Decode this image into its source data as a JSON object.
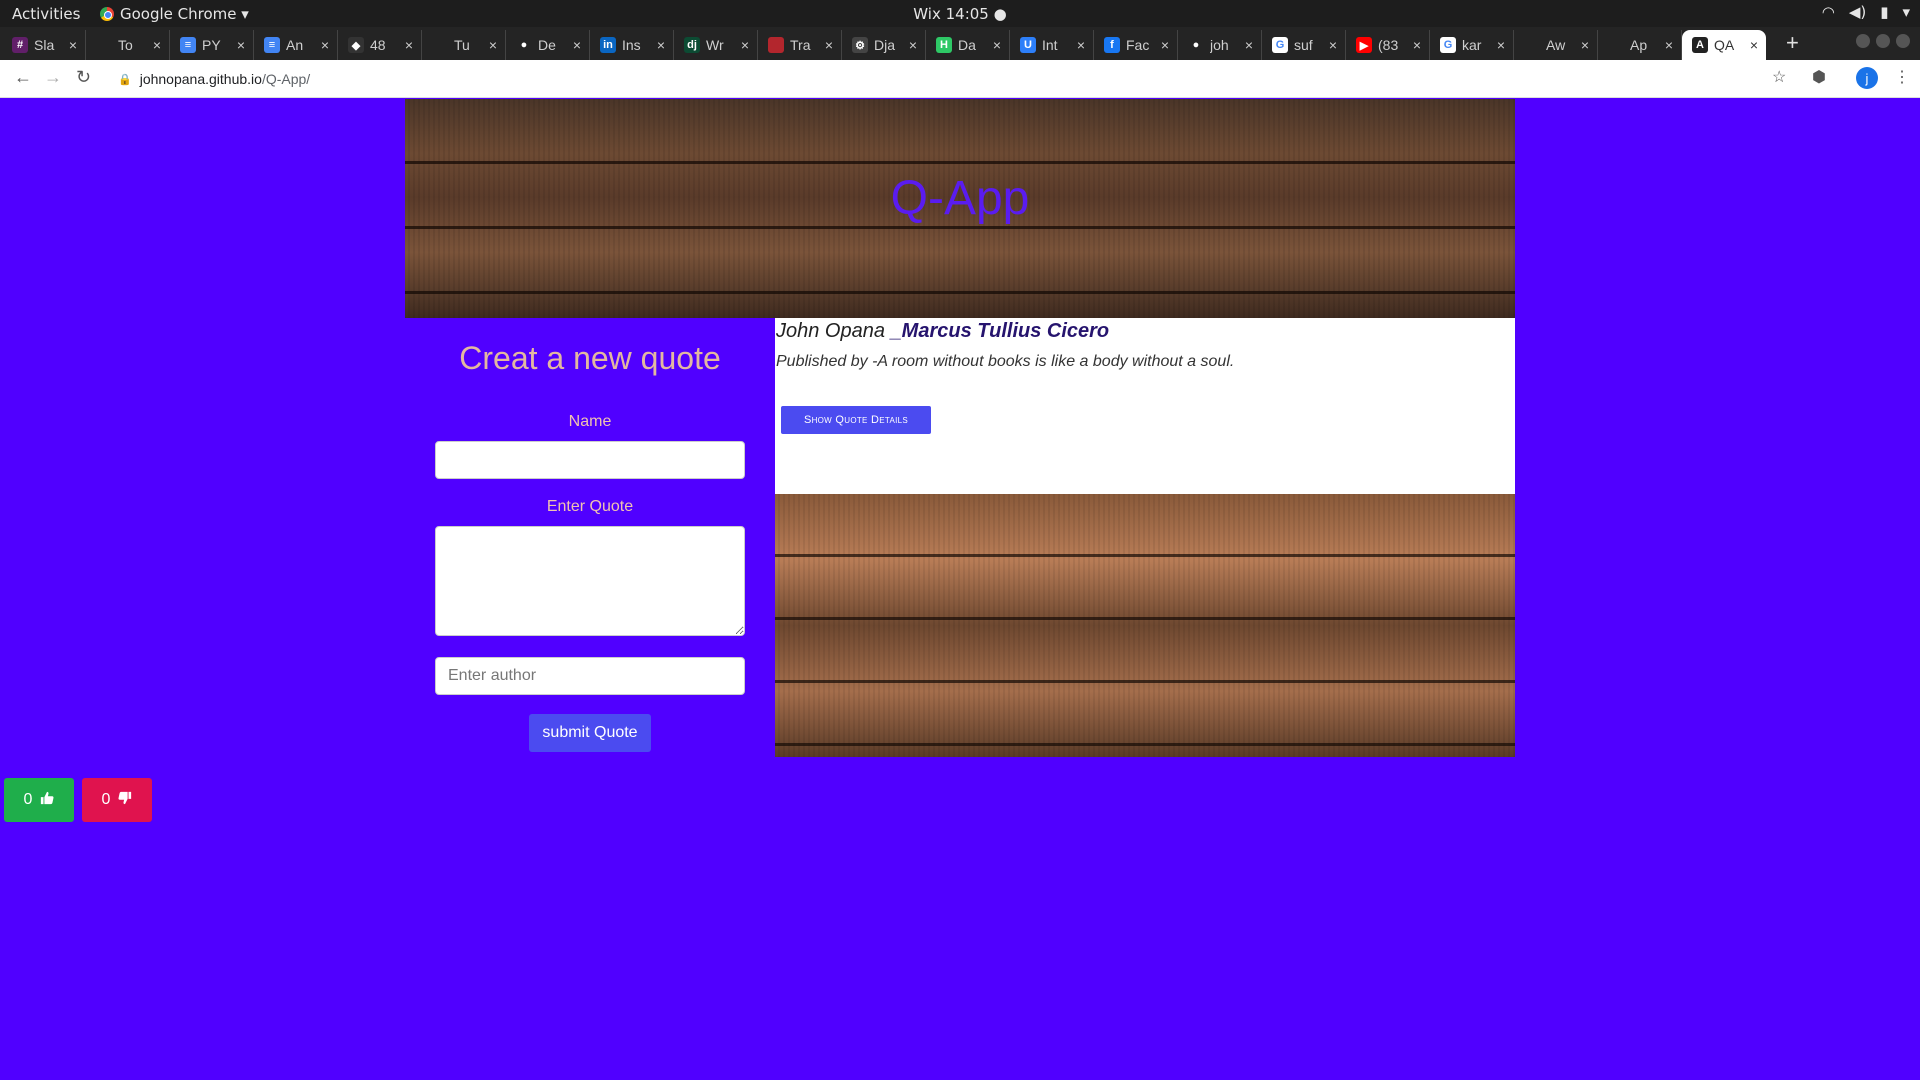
{
  "system": {
    "activities": "Activities",
    "app_name": "Google Chrome ▾",
    "clock": "Wix 14:05 ●"
  },
  "tabs": [
    {
      "title": "Sla",
      "fav_color": "#611f69",
      "fav_glyph": "#"
    },
    {
      "title": "To",
      "fav_color": "#242424",
      "fav_glyph": ""
    },
    {
      "title": "PY",
      "fav_color": "#4285f4",
      "fav_glyph": "≡"
    },
    {
      "title": "An",
      "fav_color": "#4285f4",
      "fav_glyph": "≡"
    },
    {
      "title": "48",
      "fav_color": "#333333",
      "fav_glyph": "◆"
    },
    {
      "title": "Tu",
      "fav_color": "#242424",
      "fav_glyph": ""
    },
    {
      "title": "De",
      "fav_color": "#242424",
      "fav_glyph": "●"
    },
    {
      "title": "Ins",
      "fav_color": "#0a66c2",
      "fav_glyph": "in"
    },
    {
      "title": "Wr",
      "fav_color": "#0c4b33",
      "fav_glyph": "dj"
    },
    {
      "title": "Tra",
      "fav_color": "#b3262d",
      "fav_glyph": ""
    },
    {
      "title": "Dja",
      "fav_color": "#444444",
      "fav_glyph": "⚙"
    },
    {
      "title": "Da",
      "fav_color": "#2ec866",
      "fav_glyph": "H"
    },
    {
      "title": "Int",
      "fav_color": "#2d7ff9",
      "fav_glyph": "U"
    },
    {
      "title": "Fac",
      "fav_color": "#1877f2",
      "fav_glyph": "f"
    },
    {
      "title": "joh",
      "fav_color": "#242424",
      "fav_glyph": "●"
    },
    {
      "title": "suf",
      "fav_color": "#ffffff",
      "fav_glyph": "G"
    },
    {
      "title": "(83",
      "fav_color": "#ff0000",
      "fav_glyph": "▶"
    },
    {
      "title": "kar",
      "fav_color": "#ffffff",
      "fav_glyph": "G"
    },
    {
      "title": "Aw",
      "fav_color": "#242424",
      "fav_glyph": ""
    },
    {
      "title": "Ap",
      "fav_color": "#242424",
      "fav_glyph": ""
    },
    {
      "title": "QA",
      "fav_color": "#222222",
      "fav_glyph": "A",
      "active": true
    }
  ],
  "address": {
    "host": "johnopana.github.io",
    "path": "/Q-App/"
  },
  "page": {
    "hero_title": "Q-App",
    "form": {
      "title": "Creat a new quote",
      "name_label": "Name",
      "name_value": "",
      "quote_label": "Enter Quote",
      "quote_value": "",
      "author_placeholder": "Enter author",
      "submit_label": "submit Quote"
    },
    "quote": {
      "name": "John Opana",
      "author": "_Marcus Tullius Cicero",
      "published": "Published by -A room without books is like a body without a soul.",
      "details_button": "Show Quote Details"
    },
    "votes": {
      "upvotes": "0",
      "downvotes": "0"
    }
  },
  "colors": {
    "page_bg": "#5000ff",
    "button": "#4b4bf0",
    "upvote": "#1fae4b",
    "downvote": "#e0134e"
  }
}
